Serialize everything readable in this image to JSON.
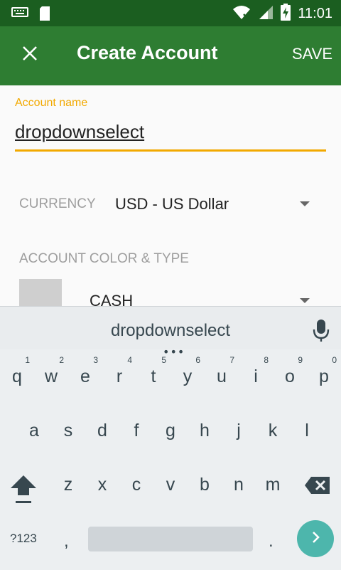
{
  "status_bar": {
    "time": "11:01",
    "icons": [
      "keyboard-icon",
      "sd-card-icon",
      "wifi-icon",
      "signal-icon",
      "battery-charging-icon"
    ]
  },
  "app_bar": {
    "close_icon": "close-icon",
    "title": "Create Account",
    "save_label": "SAVE",
    "color": "#2e7d32"
  },
  "form": {
    "account_name": {
      "label": "Account name",
      "value": "dropdownselect",
      "accent_color": "#f2a900"
    },
    "currency": {
      "label": "CURRENCY",
      "value": "USD - US Dollar"
    },
    "color_type": {
      "label": "ACCOUNT COLOR & TYPE",
      "type_value": "CASH"
    }
  },
  "keyboard": {
    "suggestion": "dropdownselect",
    "row1": [
      {
        "key": "q",
        "hint": "1"
      },
      {
        "key": "w",
        "hint": "2"
      },
      {
        "key": "e",
        "hint": "3"
      },
      {
        "key": "r",
        "hint": "4"
      },
      {
        "key": "t",
        "hint": "5"
      },
      {
        "key": "y",
        "hint": "6"
      },
      {
        "key": "u",
        "hint": "7"
      },
      {
        "key": "i",
        "hint": "8"
      },
      {
        "key": "o",
        "hint": "9"
      },
      {
        "key": "p",
        "hint": "0"
      }
    ],
    "row2": [
      "a",
      "s",
      "d",
      "f",
      "g",
      "h",
      "j",
      "k",
      "l"
    ],
    "row3": [
      "z",
      "x",
      "c",
      "v",
      "b",
      "n",
      "m"
    ],
    "symbols_label": "?123",
    "comma": ",",
    "period": ".",
    "enter_color": "#4db6ac"
  }
}
